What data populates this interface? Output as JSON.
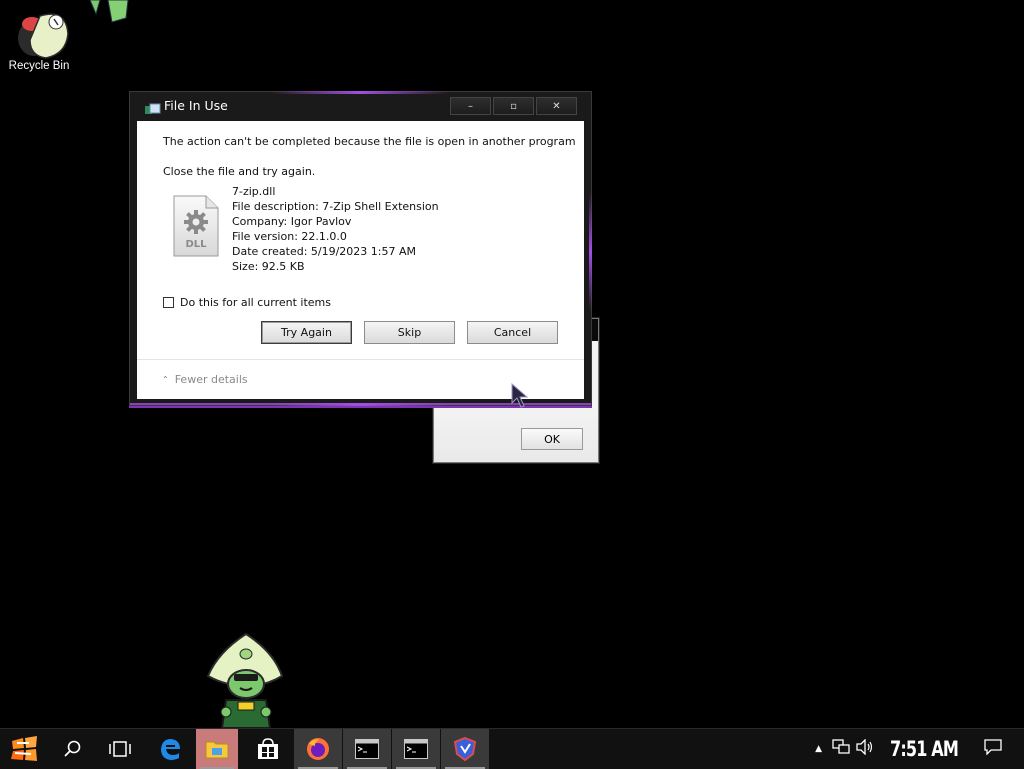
{
  "desktop": {
    "recycle_bin_label": "Recycle Bin"
  },
  "dialog": {
    "title": "File In Use",
    "minimize_label": "–",
    "maximize_label": "▫",
    "close_label": "✕",
    "message": "The action can't be completed because the file is open in another program",
    "instruction": "Close the file and try again.",
    "file_icon_text": "DLL",
    "file": {
      "name": "7-zip.dll",
      "description": "File description: 7-Zip Shell Extension",
      "company": "Company: Igor Pavlov",
      "version": "File version: 22.1.0.0",
      "created": "Date created: 5/19/2023 1:57 AM",
      "size": "Size: 92.5 KB"
    },
    "checkbox_label": "Do this for all current items",
    "buttons": {
      "try_again": "Try Again",
      "skip": "Skip",
      "cancel": "Cancel"
    },
    "fewer_details": "Fewer details"
  },
  "background_dialog": {
    "ok_label": "OK"
  },
  "taskbar": {
    "clock": "7:51 AM",
    "items": [
      "start",
      "search",
      "task-view",
      "edge",
      "file-explorer",
      "store",
      "firefox",
      "terminal",
      "terminal",
      "app"
    ]
  },
  "colors": {
    "accent": "#a24fe0",
    "desktop": "#000000",
    "taskbar": "#111111"
  }
}
